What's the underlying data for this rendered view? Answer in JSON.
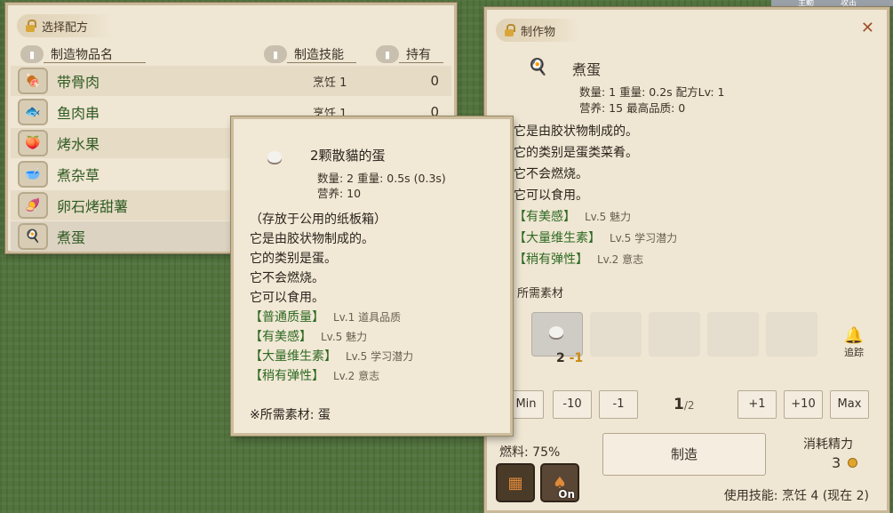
{
  "left_panel": {
    "title": "选择配方",
    "columns": {
      "name": "制造物品名",
      "skill": "制造技能",
      "owned": "持有"
    },
    "recipes": [
      {
        "name": "带骨肉",
        "skill": "烹饪 1",
        "owned": "0",
        "icon": "meat-icon"
      },
      {
        "name": "鱼肉串",
        "skill": "烹饪 1",
        "owned": "0",
        "icon": "fish-skewer-icon"
      },
      {
        "name": "烤水果",
        "skill": "",
        "owned": "",
        "icon": "roast-fruit-icon"
      },
      {
        "name": "煮杂草",
        "skill": "",
        "owned": "",
        "icon": "boiled-weeds-icon"
      },
      {
        "name": "卵石烤甜薯",
        "skill": "",
        "owned": "",
        "icon": "sweet-potato-icon"
      },
      {
        "name": "煮蛋",
        "skill": "",
        "owned": "",
        "icon": "boiled-egg-icon"
      }
    ]
  },
  "right_panel": {
    "title": "制作物",
    "product": {
      "name": "煮蛋",
      "stat1": "数量: 1  重量: 0.2s  配方Lv: 1",
      "stat2": "营养: 15  最高品质: 0"
    },
    "desc": [
      "它是由胶状物制成的。",
      "它的类别是蛋类菜肴。",
      "它不会燃烧。",
      "它可以食用。"
    ],
    "traits": [
      {
        "name": "【有美感】",
        "detail": "Lv.5 魅力"
      },
      {
        "name": "【大量维生素】",
        "detail": "Lv.5 学习潜力"
      },
      {
        "name": "【稍有弹性】",
        "detail": "Lv.2 意志"
      }
    ],
    "materials_label": "所需素材",
    "slot_count": "2",
    "slot_minus": "-1",
    "trace_label": "追踪",
    "qty_buttons": {
      "min": "Min",
      "m10": "-10",
      "m1": "-1",
      "p1": "+1",
      "p10": "+10",
      "max": "Max"
    },
    "qty_current": "1",
    "qty_total": "/2",
    "fuel_label": "燃料: 75%",
    "on_label": "On",
    "make_label": "制造",
    "stamina_label": "消耗精力",
    "stamina_value": "3",
    "skill_used": "使用技能: 烹饪 4 (现在 2)"
  },
  "tooltip": {
    "name": "2颗散貓的蛋",
    "stat1": "数量: 2  重量: 0.5s (0.3s)",
    "stat2": "营养: 10",
    "lines": [
      "（存放于公用的纸板箱）",
      "它是由胶状物制成的。",
      "它的类别是蛋。",
      "它不会燃烧。",
      "它可以食用。"
    ],
    "traits": [
      {
        "name": "【普通质量】",
        "detail": "Lv.1 道具品质"
      },
      {
        "name": "【有美感】",
        "detail": "Lv.5 魅力"
      },
      {
        "name": "【大量维生素】",
        "detail": "Lv.5 学习潜力"
      },
      {
        "name": "【稍有弹性】",
        "detail": "Lv.2 意志"
      }
    ],
    "required": "※所需素材: 蛋"
  },
  "top_right": {
    "a": "主動",
    "b": "攻击"
  }
}
